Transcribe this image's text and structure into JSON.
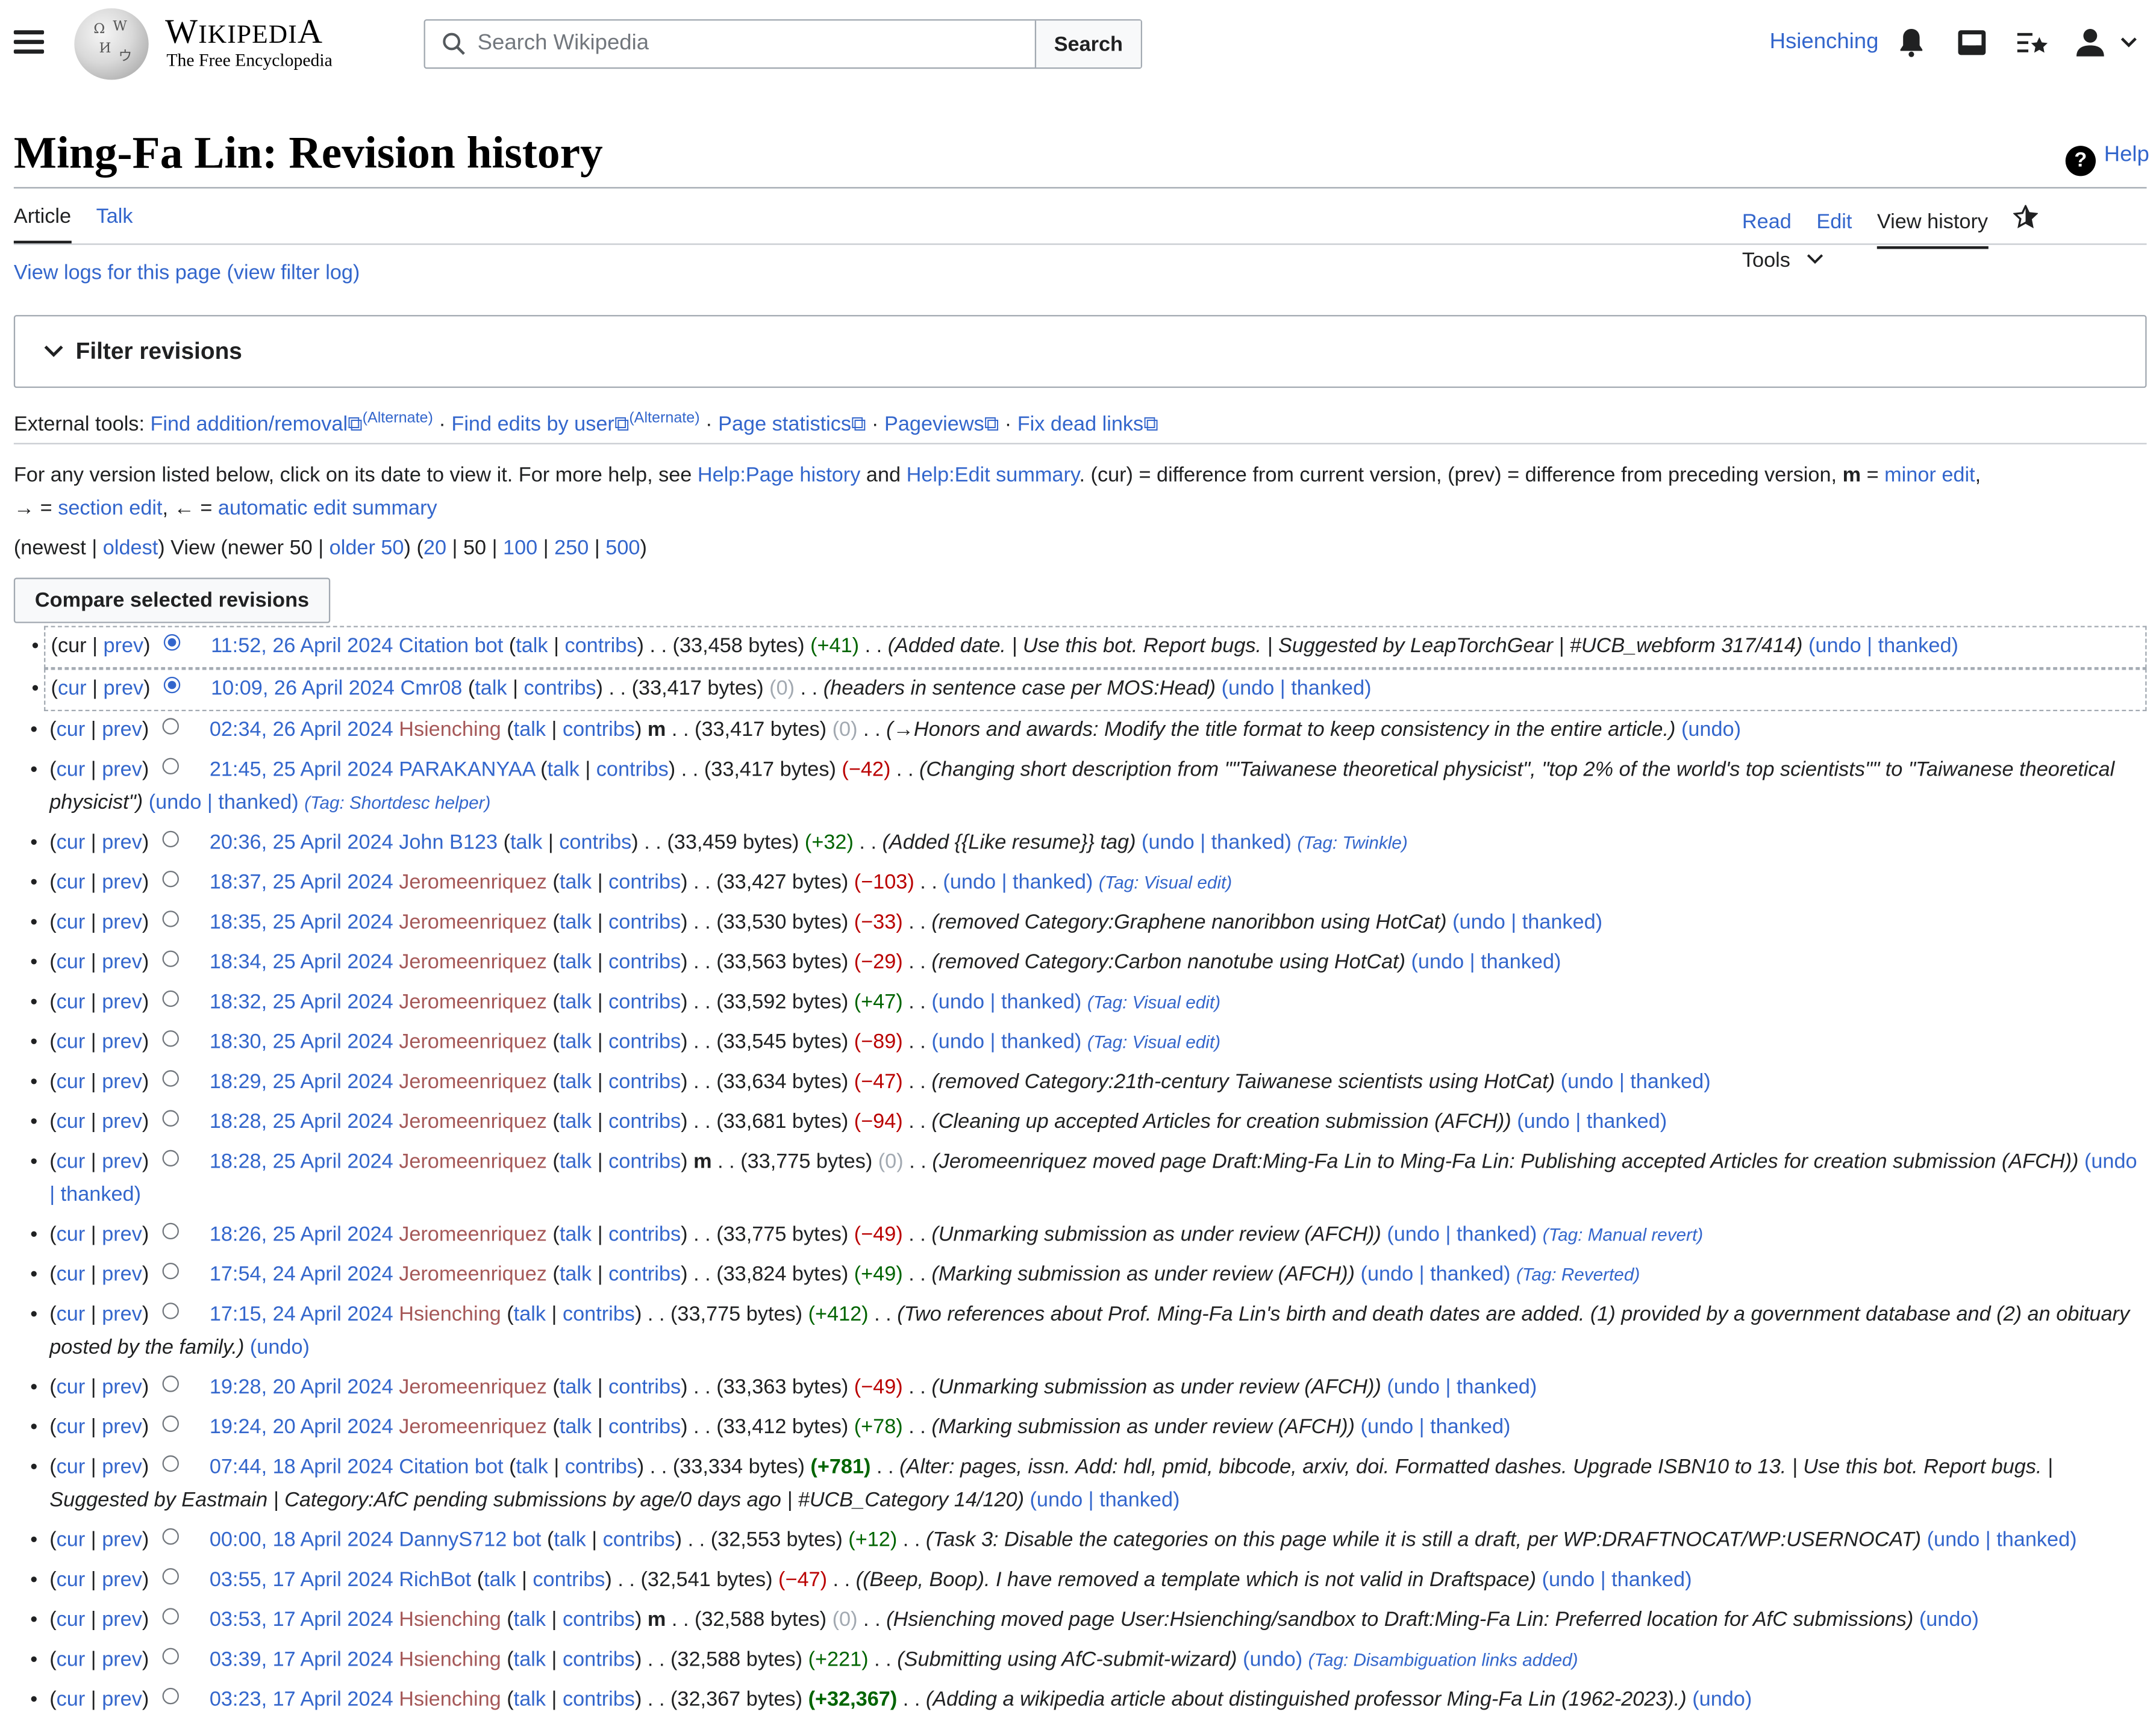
{
  "header": {
    "wordmark_big": "W",
    "wordmark_rest": "IKIPEDI",
    "wordmark_end": "A",
    "tagline": "The Free Encyclopedia",
    "search_placeholder": "Search Wikipedia",
    "search_button": "Search",
    "username": "Hsienching"
  },
  "page": {
    "title": "Ming-Fa Lin: Revision history",
    "help": "Help",
    "tabs_left": [
      "Article",
      "Talk"
    ],
    "tabs_right": [
      "Read",
      "Edit",
      "View history"
    ],
    "tools": "Tools",
    "logs": "View logs for this page (view filter log)",
    "filter": "Filter revisions"
  },
  "ext_tools": {
    "label": "External tools:",
    "items": [
      "Find addition/removal",
      "(Alternate)",
      "Find edits by user",
      "(Alternate)",
      "Page statistics",
      "Pageviews",
      "Fix dead links"
    ]
  },
  "help_text": {
    "p1": "For any version listed below, click on its date to view it. For more help, see ",
    "l1": "Help:Page history",
    "p2": " and ",
    "l2": "Help:Edit summary",
    "p3": ". (cur) = difference from current version, (prev) = difference from preceding version, ",
    "m": "m",
    "p4": " = ",
    "l3": "minor edit",
    "p5": ",",
    "p6": "→ = ",
    "l4": "section edit",
    "p7": ", ← = ",
    "l5": "automatic edit summary"
  },
  "nav": {
    "newest": "newest",
    "oldest": "oldest",
    "view": "View (newer 50 | ",
    "older": "older 50",
    "sizes": [
      "20",
      "50",
      "100",
      "250",
      "500"
    ]
  },
  "compare_button": "Compare selected revisions",
  "revisions": [
    {
      "date": "11:52, 26 April 2024",
      "user": "Citation bot",
      "minor": false,
      "bytes": "(33,458 bytes)",
      "diff": "(+41)",
      "summary": "(Added date. | Use this bot. Report bugs. | Suggested by LeapTorchGear | #UCB_webform 317/414)",
      "actions": "(undo | thanked)",
      "tag": ""
    },
    {
      "date": "10:09, 26 April 2024",
      "user": "Cmr08",
      "minor": false,
      "bytes": "(33,417 bytes)",
      "diff": "(0)",
      "summary": "(headers in sentence case per MOS:Head)",
      "actions": "(undo | thanked)",
      "tag": ""
    },
    {
      "date": "02:34, 26 April 2024",
      "user": "Hsienching",
      "minor": true,
      "bytes": "(33,417 bytes)",
      "diff": "(0)",
      "summary": "(→Honors and awards: Modify the title format to keep consistency in the entire article.)",
      "actions": "(undo)",
      "tag": ""
    },
    {
      "date": "21:45, 25 April 2024",
      "user": "PARAKANYAA",
      "minor": false,
      "bytes": "(33,417 bytes)",
      "diff": "(−42)",
      "summary": "(Changing short description from \"\"Taiwanese theoretical physicist\", \"top 2% of the world's top scientists\"\" to \"Taiwanese theoretical physicist\")",
      "actions": "(undo | thanked)",
      "tag": "(Tag: Shortdesc helper)"
    },
    {
      "date": "20:36, 25 April 2024",
      "user": "John B123",
      "minor": false,
      "bytes": "(33,459 bytes)",
      "diff": "(+32)",
      "summary": "(Added {{Like resume}} tag)",
      "actions": "(undo | thanked)",
      "tag": "(Tag: Twinkle)"
    },
    {
      "date": "18:37, 25 April 2024",
      "user": "Jeromeenriquez",
      "minor": false,
      "bytes": "(33,427 bytes)",
      "diff": "(−103)",
      "summary": "",
      "actions": "(undo | thanked)",
      "tag": "(Tag: Visual edit)"
    },
    {
      "date": "18:35, 25 April 2024",
      "user": "Jeromeenriquez",
      "minor": false,
      "bytes": "(33,530 bytes)",
      "diff": "(−33)",
      "summary": "(removed Category:Graphene nanoribbon using HotCat)",
      "actions": "(undo | thanked)",
      "tag": ""
    },
    {
      "date": "18:34, 25 April 2024",
      "user": "Jeromeenriquez",
      "minor": false,
      "bytes": "(33,563 bytes)",
      "diff": "(−29)",
      "summary": "(removed Category:Carbon nanotube using HotCat)",
      "actions": "(undo | thanked)",
      "tag": ""
    },
    {
      "date": "18:32, 25 April 2024",
      "user": "Jeromeenriquez",
      "minor": false,
      "bytes": "(33,592 bytes)",
      "diff": "(+47)",
      "summary": "",
      "actions": "(undo | thanked)",
      "tag": "(Tag: Visual edit)"
    },
    {
      "date": "18:30, 25 April 2024",
      "user": "Jeromeenriquez",
      "minor": false,
      "bytes": "(33,545 bytes)",
      "diff": "(−89)",
      "summary": "",
      "actions": "(undo | thanked)",
      "tag": "(Tag: Visual edit)"
    },
    {
      "date": "18:29, 25 April 2024",
      "user": "Jeromeenriquez",
      "minor": false,
      "bytes": "(33,634 bytes)",
      "diff": "(−47)",
      "summary": "(removed Category:21th-century Taiwanese scientists using HotCat)",
      "actions": "(undo | thanked)",
      "tag": ""
    },
    {
      "date": "18:28, 25 April 2024",
      "user": "Jeromeenriquez",
      "minor": false,
      "bytes": "(33,681 bytes)",
      "diff": "(−94)",
      "summary": "(Cleaning up accepted Articles for creation submission (AFCH))",
      "actions": "(undo | thanked)",
      "tag": ""
    },
    {
      "date": "18:28, 25 April 2024",
      "user": "Jeromeenriquez",
      "minor": true,
      "bytes": "(33,775 bytes)",
      "diff": "(0)",
      "summary": "(Jeromeenriquez moved page Draft:Ming-Fa Lin to Ming-Fa Lin: Publishing accepted Articles for creation submission (AFCH))",
      "actions": "(undo | thanked)",
      "tag": ""
    },
    {
      "date": "18:26, 25 April 2024",
      "user": "Jeromeenriquez",
      "minor": false,
      "bytes": "(33,775 bytes)",
      "diff": "(−49)",
      "summary": "(Unmarking submission as under review (AFCH))",
      "actions": "(undo | thanked)",
      "tag": "(Tag: Manual revert)"
    },
    {
      "date": "17:54, 24 April 2024",
      "user": "Jeromeenriquez",
      "minor": false,
      "bytes": "(33,824 bytes)",
      "diff": "(+49)",
      "summary": "(Marking submission as under review (AFCH))",
      "actions": "(undo | thanked)",
      "tag": "(Tag: Reverted)"
    },
    {
      "date": "17:15, 24 April 2024",
      "user": "Hsienching",
      "minor": false,
      "bytes": "(33,775 bytes)",
      "diff": "(+412)",
      "summary": "(Two references about Prof. Ming-Fa Lin's birth and death dates are added. (1) provided by a government database and (2) an obituary posted by the family.)",
      "actions": "(undo)",
      "tag": ""
    },
    {
      "date": "19:28, 20 April 2024",
      "user": "Jeromeenriquez",
      "minor": false,
      "bytes": "(33,363 bytes)",
      "diff": "(−49)",
      "summary": "(Unmarking submission as under review (AFCH))",
      "actions": "(undo | thanked)",
      "tag": ""
    },
    {
      "date": "19:24, 20 April 2024",
      "user": "Jeromeenriquez",
      "minor": false,
      "bytes": "(33,412 bytes)",
      "diff": "(+78)",
      "summary": "(Marking submission as under review (AFCH))",
      "actions": "(undo | thanked)",
      "tag": ""
    },
    {
      "date": "07:44, 18 April 2024",
      "user": "Citation bot",
      "minor": false,
      "bytes": "(33,334 bytes)",
      "diff": "(+781)",
      "summary": "(Alter: pages, issn. Add: hdl, pmid, bibcode, arxiv, doi. Formatted dashes. Upgrade ISBN10 to 13. | Use this bot. Report bugs. | Suggested by Eastmain | Category:AfC pending submissions by age/0 days ago | #UCB_Category 14/120)",
      "actions": "(undo | thanked)",
      "tag": ""
    },
    {
      "date": "00:00, 18 April 2024",
      "user": "DannyS712 bot",
      "minor": false,
      "bytes": "(32,553 bytes)",
      "diff": "(+12)",
      "summary": "(Task 3: Disable the categories on this page while it is still a draft, per WP:DRAFTNOCAT/WP:USERNOCAT)",
      "actions": "(undo | thanked)",
      "tag": ""
    },
    {
      "date": "03:55, 17 April 2024",
      "user": "RichBot",
      "minor": false,
      "bytes": "(32,541 bytes)",
      "diff": "(−47)",
      "summary": "((Beep, Boop). I have removed a template which is not valid in Draftspace)",
      "actions": "(undo | thanked)",
      "tag": ""
    },
    {
      "date": "03:53, 17 April 2024",
      "user": "Hsienching",
      "minor": true,
      "bytes": "(32,588 bytes)",
      "diff": "(0)",
      "summary": "(Hsienching moved page User:Hsienching/sandbox to Draft:Ming-Fa Lin: Preferred location for AfC submissions)",
      "actions": "(undo)",
      "tag": ""
    },
    {
      "date": "03:39, 17 April 2024",
      "user": "Hsienching",
      "minor": false,
      "bytes": "(32,588 bytes)",
      "diff": "(+221)",
      "summary": "(Submitting using AfC-submit-wizard)",
      "actions": "(undo)",
      "tag": "(Tag: Disambiguation links added)"
    },
    {
      "date": "03:23, 17 April 2024",
      "user": "Hsienching",
      "minor": false,
      "bytes": "(32,367 bytes)",
      "diff": "(+32,367)",
      "summary": "(Adding a wikipedia article about distinguished professor Ming-Fa Lin (1962-2023).)",
      "actions": "(undo)",
      "tag": ""
    }
  ],
  "rev_labels": {
    "cur": "cur",
    "prev": "prev",
    "talk": "talk",
    "contribs": "contribs",
    "minor_mark": "m",
    "dots": ". ."
  }
}
